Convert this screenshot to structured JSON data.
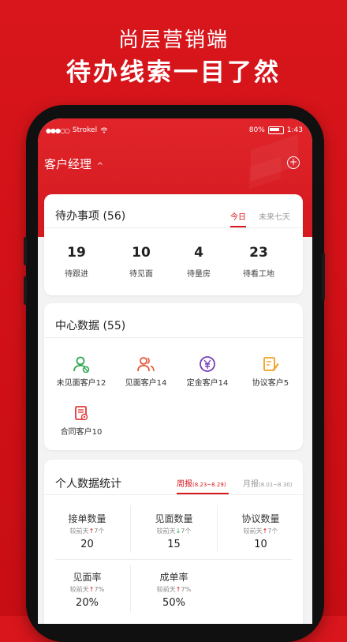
{
  "hero": {
    "subtitle": "尚层营销端",
    "title": "待办线索一目了然"
  },
  "status_bar": {
    "carrier": "Strokel",
    "battery": "80%",
    "time": "1:43"
  },
  "nav": {
    "title": "客户经理",
    "caret": "^",
    "add": "+"
  },
  "todo": {
    "title": "待办事项 (56)",
    "tabs": [
      {
        "label": "今日",
        "active": true
      },
      {
        "label": "未来七天",
        "active": false
      }
    ],
    "items": [
      {
        "value": "19",
        "label": "待跟进"
      },
      {
        "value": "10",
        "label": "待见面"
      },
      {
        "value": "4",
        "label": "待量房"
      },
      {
        "value": "23",
        "label": "待看工地"
      }
    ]
  },
  "center": {
    "title": "中心数据 (55)",
    "items": [
      {
        "label": "未见面客户12",
        "icon": "user-icon",
        "color": "#2ea84f"
      },
      {
        "label": "见面客户14",
        "icon": "users-icon",
        "color": "#e8543a"
      },
      {
        "label": "定金客户14",
        "icon": "yen-icon",
        "color": "#7a3fb8"
      },
      {
        "label": "协议客户5",
        "icon": "edit-doc-icon",
        "color": "#f0a020"
      },
      {
        "label": "合同客户10",
        "icon": "contract-icon",
        "color": "#e23a3a"
      }
    ]
  },
  "stats": {
    "title": "个人数据统计",
    "tabs": [
      {
        "label": "周报",
        "range": "(8.23~8.29)",
        "active": true
      },
      {
        "label": "月报",
        "range": "(8.01~8.30)",
        "active": false
      }
    ],
    "cells": [
      {
        "label": "接单数量",
        "compare_prefix": "较前天",
        "direction": "up",
        "change": "7个",
        "value": "20"
      },
      {
        "label": "见面数量",
        "compare_prefix": "较前天",
        "direction": "down",
        "change": "7个",
        "value": "15"
      },
      {
        "label": "协议数量",
        "compare_prefix": "较前天",
        "direction": "up",
        "change": "7个",
        "value": "10"
      },
      {
        "label": "见面率",
        "compare_prefix": "较前天",
        "direction": "up",
        "change": "7%",
        "value": "20%"
      },
      {
        "label": "成单率",
        "compare_prefix": "较前天",
        "direction": "up",
        "change": "7%",
        "value": "50%"
      }
    ]
  },
  "colors": {
    "brand_red": "#d6191f",
    "up_red": "#d6191f",
    "down_green": "#1aa84a"
  }
}
